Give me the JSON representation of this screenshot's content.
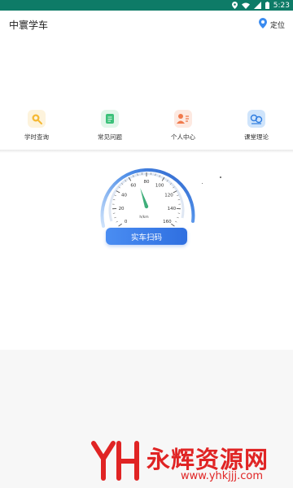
{
  "status_bar": {
    "time": "5:23",
    "icons": [
      "location-icon",
      "wifi-icon",
      "signal-icon",
      "battery-icon"
    ]
  },
  "header": {
    "title": "中寰学车",
    "location_label": "定位"
  },
  "shortcuts": [
    {
      "label": "学时查询",
      "icon": "search-record-icon",
      "color": "#f5b935",
      "bg": "#fdf3dc"
    },
    {
      "label": "常见问题",
      "icon": "notepad-icon",
      "color": "#3cc17a",
      "bg": "#e2f6ea"
    },
    {
      "label": "个人中心",
      "icon": "person-icon",
      "color": "#f07a4d",
      "bg": "#fde9e1"
    },
    {
      "label": "课堂理论",
      "icon": "classroom-icon",
      "color": "#2f7de0",
      "bg": "#cfe4fb"
    }
  ],
  "speedometer": {
    "ticks": [
      "0",
      "20",
      "40",
      "60",
      "80",
      "100",
      "120",
      "140",
      "160"
    ],
    "unit": "h/km",
    "needle_value": 68,
    "max": 160
  },
  "scan_button": {
    "label": "实车扫码"
  },
  "watermark": {
    "text": "永辉资源网",
    "url": "www.yhkjjj.com"
  },
  "colors": {
    "status_bar": "#0e7b67",
    "accent_blue": "#2f6fe0",
    "needle_green": "#3fae7a",
    "watermark_red": "#e02424"
  }
}
